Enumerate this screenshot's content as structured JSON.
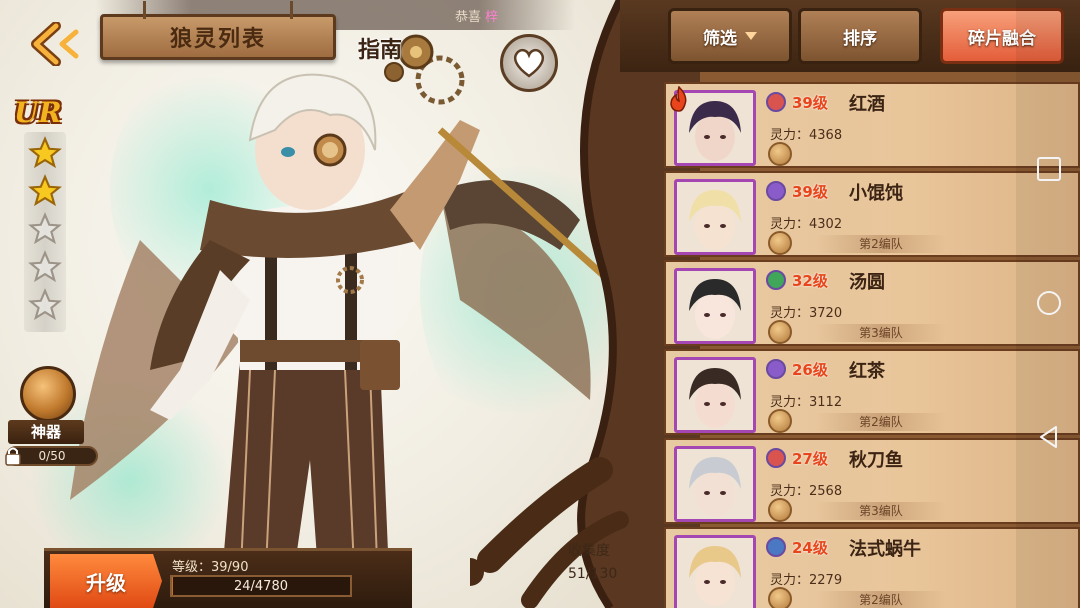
{
  "header": {
    "title": "狼灵列表",
    "guide_label": "指南",
    "announcement_prefix": "恭喜",
    "announcement_highlight": "梓"
  },
  "hero": {
    "rarity": "UR",
    "stars_filled": 2,
    "stars_total": 5,
    "artifact_label": "神器",
    "artifact_progress": "0/50",
    "upgrade_label": "升级",
    "level_text": "等级：39/90",
    "exp_text": "24/4780",
    "exp_current": 24,
    "exp_max": 4780
  },
  "collection": {
    "label": "收集度",
    "value": "51/130"
  },
  "toolbar": {
    "filter_label": "筛选",
    "sort_label": "排序",
    "fusion_label": "碎片融合"
  },
  "cards": [
    {
      "level": "39级",
      "name": "红酒",
      "power_label": "灵力：",
      "power": "4368",
      "team": "",
      "badge_color": "#d9534f",
      "hair": "#3b2a4a",
      "skin": "#f0d6c8"
    },
    {
      "level": "39级",
      "name": "小馄饨",
      "power_label": "灵力：",
      "power": "4302",
      "team": "第2编队",
      "badge_color": "#8a5cc9",
      "hair": "#f0e0a8",
      "skin": "#f6e2d0"
    },
    {
      "level": "32级",
      "name": "汤圆",
      "power_label": "灵力：",
      "power": "3720",
      "team": "第3编队",
      "badge_color": "#3fa65a",
      "hair": "#2a2a2a",
      "skin": "#f8e6dc"
    },
    {
      "level": "26级",
      "name": "红茶",
      "power_label": "灵力：",
      "power": "3112",
      "team": "第2编队",
      "badge_color": "#8a5cc9",
      "hair": "#3a2a24",
      "skin": "#f4ddd0"
    },
    {
      "level": "27级",
      "name": "秋刀鱼",
      "power_label": "灵力：",
      "power": "2568",
      "team": "第3编队",
      "badge_color": "#d9534f",
      "hair": "#c8ccd2",
      "skin": "#f3e0d4"
    },
    {
      "level": "24级",
      "name": "法式蜗牛",
      "power_label": "灵力：",
      "power": "2279",
      "team": "第2编队",
      "badge_color": "#4a78c2",
      "hair": "#e9c98a",
      "skin": "#f6e3d4"
    }
  ],
  "colors": {
    "accent_orange": "#e04a14",
    "level_red": "#e8451c",
    "wood_dark": "#3c2412",
    "portrait_border": "#a447b3"
  },
  "icons": [
    "back-arrow-icon",
    "heart-icon",
    "gear-icon",
    "star-icon",
    "lock-icon",
    "artifact-icon",
    "flame-icon",
    "coin-icon",
    "nav-square-icon",
    "nav-circle-icon",
    "nav-back-icon"
  ]
}
